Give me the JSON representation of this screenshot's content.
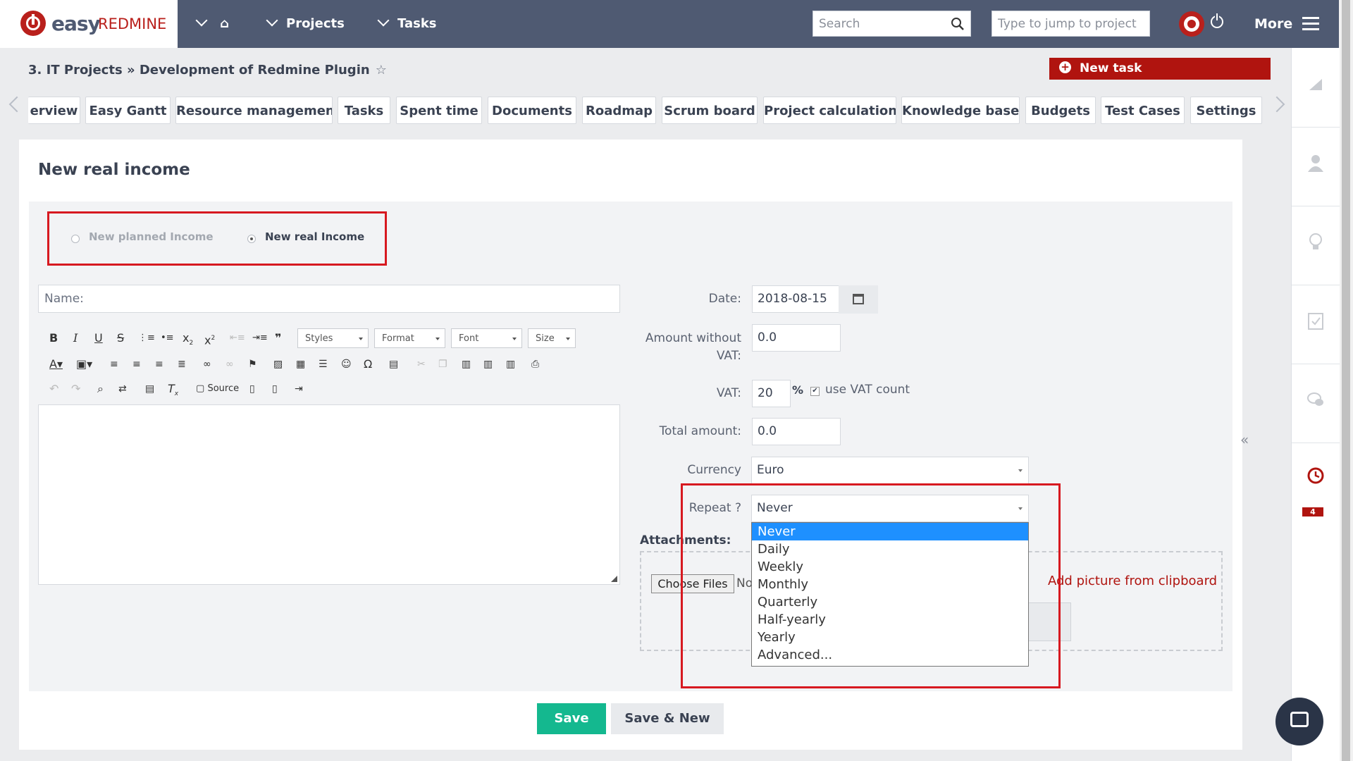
{
  "logo": {
    "easy": "easy",
    "redmine": "REDMINE"
  },
  "nav": {
    "projects": "Projects",
    "tasks": "Tasks",
    "more": "More"
  },
  "search": {
    "placeholder": "Search"
  },
  "jump": {
    "placeholder": "Type to jump to project"
  },
  "breadcrumb": {
    "text": "3. IT Projects » Development of Redmine Plugin",
    "star": "☆"
  },
  "new_task_label": "New task",
  "tabs": [
    "erview",
    "Easy Gantt",
    "Resource management",
    "Tasks",
    "Spent time",
    "Documents",
    "Roadmap",
    "Scrum board",
    "Project calculation",
    "Knowledge base",
    "Budgets",
    "Test Cases",
    "Settings"
  ],
  "page_title": "New real income",
  "income_type": {
    "planned": "New planned Income",
    "real": "New real Income",
    "selected": "real"
  },
  "name_field": {
    "label": "Name:"
  },
  "toolbar": {
    "styles": "Styles",
    "format": "Format",
    "font": "Font",
    "size": "Size",
    "source": "Source"
  },
  "form": {
    "date_label": "Date:",
    "date_value": "2018-08-15",
    "amount_label": "Amount without VAT:",
    "amount_value": "0.0",
    "vat_label": "VAT:",
    "vat_value": "20",
    "vat_percent": "%",
    "vat_count_label": "use VAT count",
    "total_label": "Total amount:",
    "total_value": "0.0",
    "currency_label": "Currency",
    "currency_value": "Euro",
    "repeat_label": "Repeat ?",
    "repeat_value": "Never",
    "repeat_options": [
      "Never",
      "Daily",
      "Weekly",
      "Monthly",
      "Quarterly",
      "Half-yearly",
      "Yearly",
      "Advanced..."
    ]
  },
  "attachments": {
    "label": "Attachments:",
    "choose": "Choose Files",
    "no_file": "No",
    "clipboard": "Add picture from clipboard"
  },
  "buttons": {
    "save": "Save",
    "save_new": "Save & New"
  },
  "rail_badge": "4",
  "colors": {
    "topbar": "#4f5a72",
    "brand_red": "#b9201c",
    "save_green": "#14b88f",
    "highlight": "#d71920",
    "selected_option": "#1e90ff"
  }
}
